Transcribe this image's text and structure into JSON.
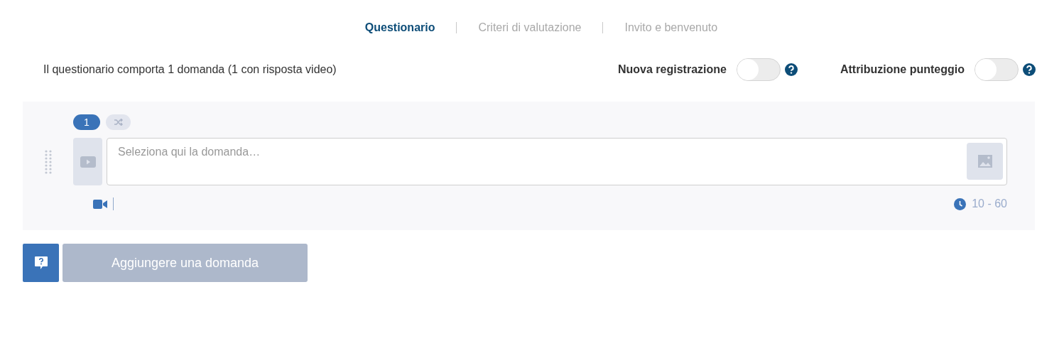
{
  "tabs": [
    {
      "label": "Questionario",
      "selected": true
    },
    {
      "label": "Criteri di valutazione",
      "selected": false
    },
    {
      "label": "Invito e benvenuto",
      "selected": false
    }
  ],
  "summary": "Il questionario comporta 1 domanda (1 con risposta video)",
  "toggles": [
    {
      "label": "Nuova registrazione",
      "on": false
    },
    {
      "label": "Attribuzione punteggio",
      "on": false
    }
  ],
  "questions": [
    {
      "number": "1",
      "placeholder": "Seleziona qui la domanda…",
      "duration": "10 - 60"
    }
  ],
  "add_button": {
    "label": "Aggiungere una domanda",
    "disabled": true
  }
}
